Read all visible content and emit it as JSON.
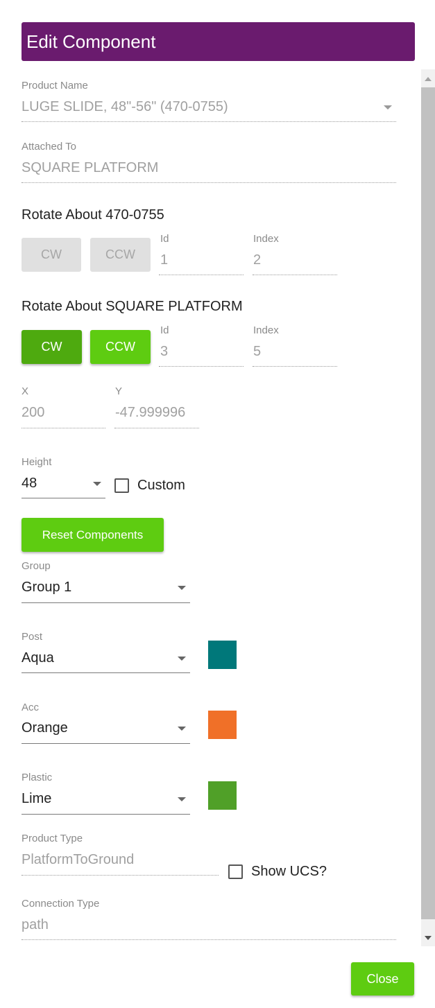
{
  "dialog": {
    "title": "Edit Component"
  },
  "product_name": {
    "label": "Product Name",
    "value": "LUGE SLIDE, 48\"-56\" (470-0755)"
  },
  "attached_to": {
    "label": "Attached To",
    "value": "SQUARE PLATFORM"
  },
  "rotate_self": {
    "heading": "Rotate About 470-0755",
    "cw": "CW",
    "ccw": "CCW",
    "id_label": "Id",
    "id_value": "1",
    "index_label": "Index",
    "index_value": "2"
  },
  "rotate_parent": {
    "heading": "Rotate About SQUARE PLATFORM",
    "cw": "CW",
    "ccw": "CCW",
    "id_label": "Id",
    "id_value": "3",
    "index_label": "Index",
    "index_value": "5"
  },
  "position": {
    "x_label": "X",
    "x_value": "200",
    "y_label": "Y",
    "y_value": "-47.999996"
  },
  "height": {
    "label": "Height",
    "value": "48",
    "custom_label": "Custom"
  },
  "reset_button": "Reset Components",
  "group": {
    "label": "Group",
    "value": "Group 1"
  },
  "post": {
    "label": "Post",
    "value": "Aqua",
    "color": "#00787a"
  },
  "acc": {
    "label": "Acc",
    "value": "Orange",
    "color": "#f07028"
  },
  "plastic": {
    "label": "Plastic",
    "value": "Lime",
    "color": "#50a028"
  },
  "product_type": {
    "label": "Product Type",
    "value": "PlatformToGround",
    "show_ucs_label": "Show UCS?"
  },
  "connection_type": {
    "label": "Connection Type",
    "value": "path"
  },
  "footer": {
    "close": "Close"
  }
}
